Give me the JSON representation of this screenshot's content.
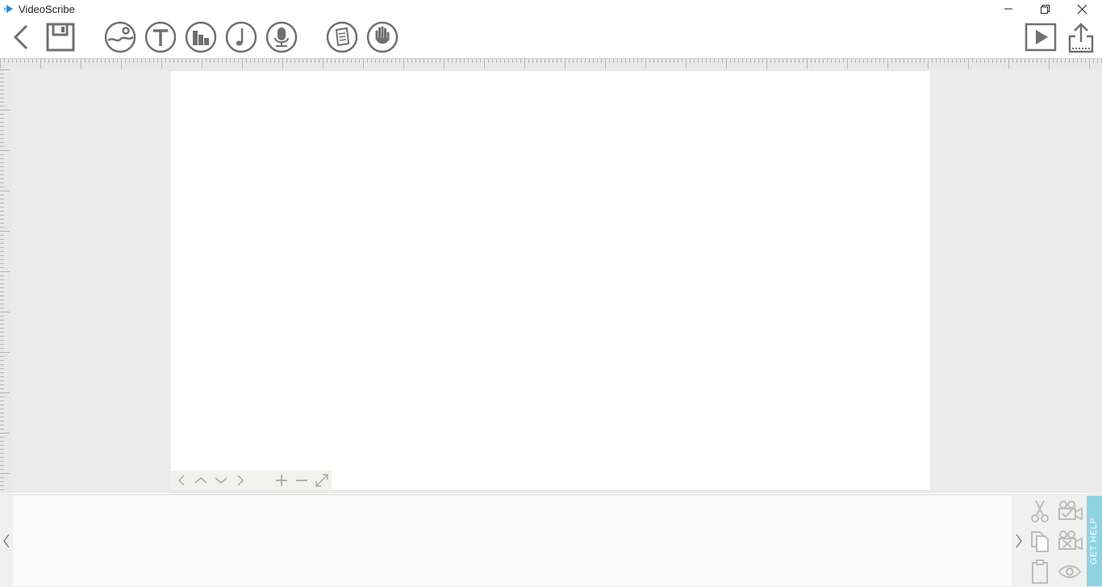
{
  "window": {
    "title": "VideoScribe",
    "brand_color": "#2a8ad6",
    "controls": [
      "minimize-icon",
      "restore-icon",
      "close-icon"
    ]
  },
  "toolbar": {
    "left_tools": [
      "back-icon",
      "save-icon"
    ],
    "insert_tools": [
      "image-icon",
      "text-icon",
      "chart-icon",
      "music-icon",
      "voiceover-icon"
    ],
    "extra_tools": [
      "properties-icon",
      "hand-icon"
    ],
    "right_tools": [
      "preview-play-icon",
      "publish-share-icon"
    ],
    "icon_color": "#707070"
  },
  "canvas_nav": {
    "icons": [
      "nav-left-icon",
      "nav-up-icon",
      "nav-down-icon",
      "nav-right-icon",
      "zoom-in-icon",
      "zoom-out-icon",
      "fit-screen-icon"
    ]
  },
  "timeline": {
    "tools": [
      "cut-icon",
      "camera-set-icon",
      "copy-icon",
      "camera-clear-icon",
      "paste-icon",
      "visibility-eye-icon"
    ],
    "get_help_label": "GET HELP",
    "get_help_color": "#8fd3e3"
  }
}
